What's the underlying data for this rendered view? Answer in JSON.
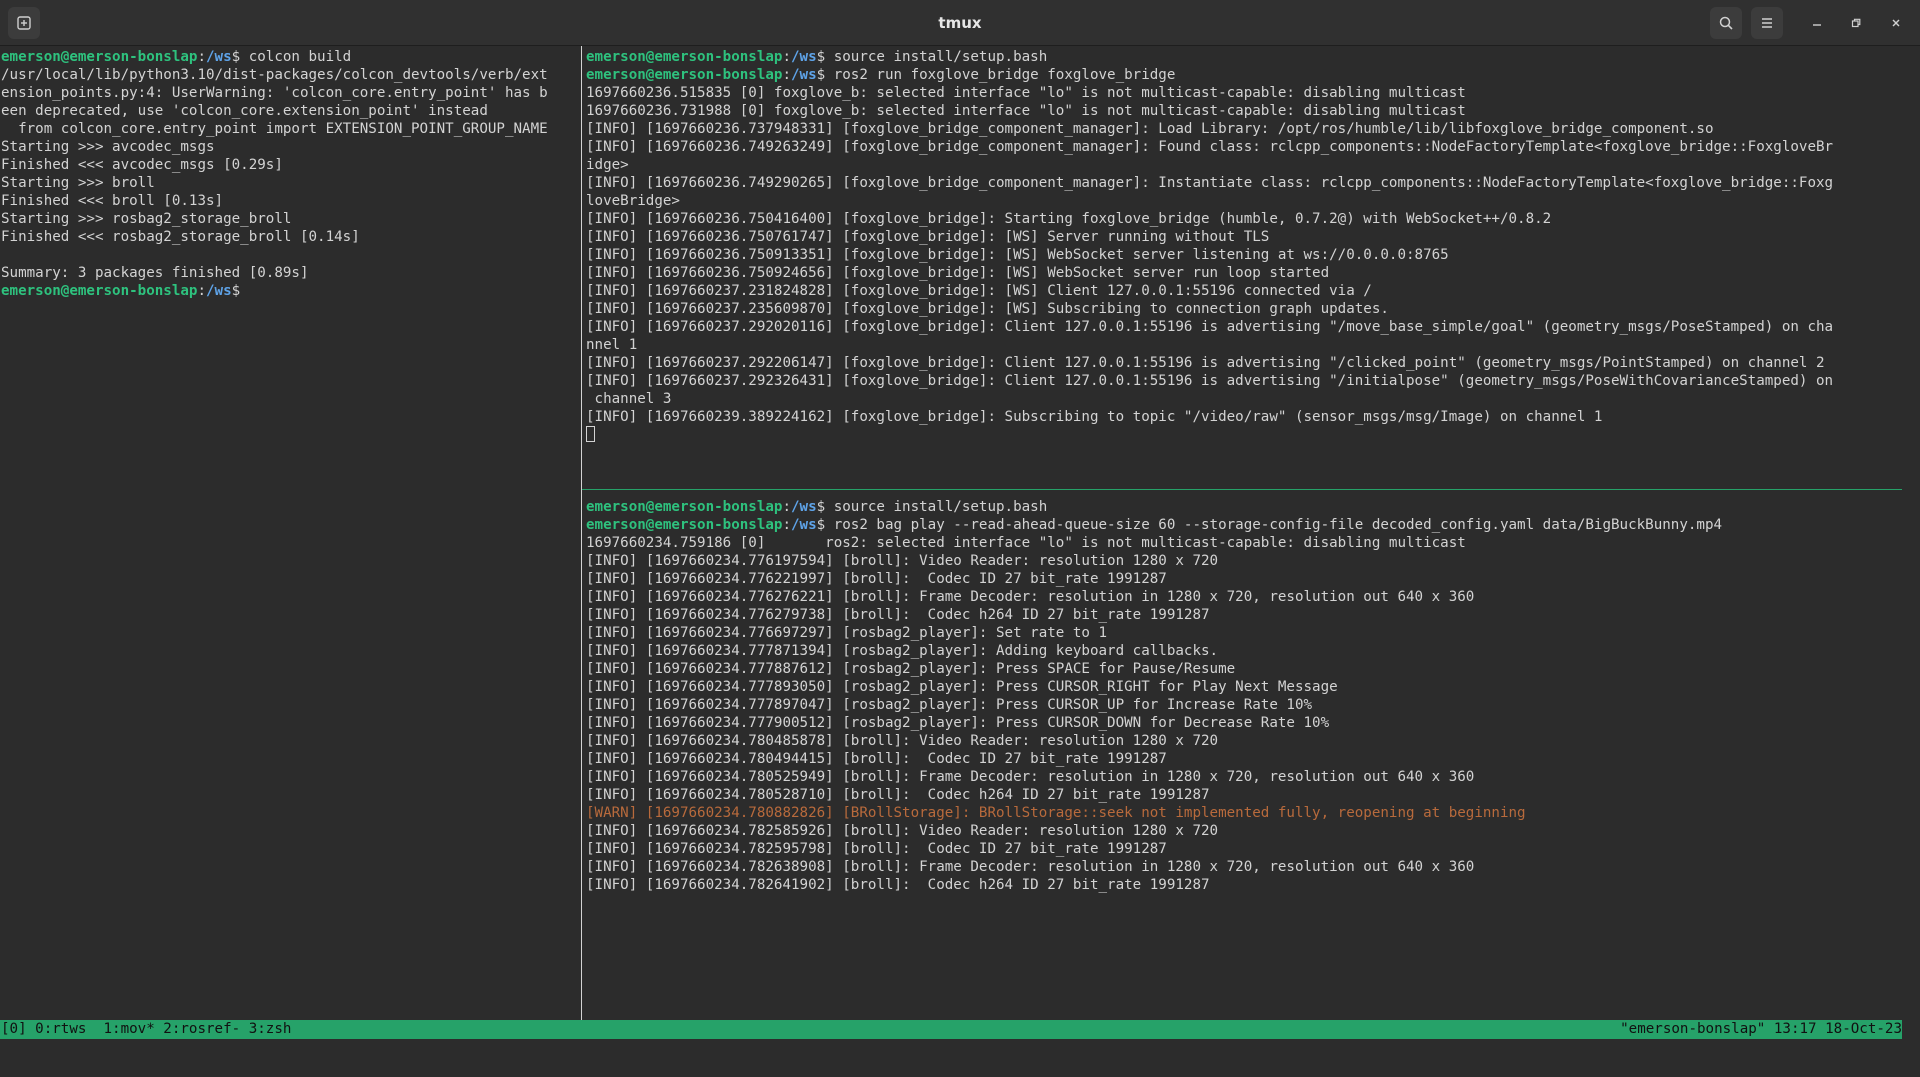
{
  "window": {
    "title": "tmux"
  },
  "colors": {
    "background": "#2c2c2c",
    "text": "#d3d3d3",
    "user": "#2ec27e",
    "path": "#5ea3e8",
    "warn": "#b86a3c",
    "statusbar": "#26a269",
    "separator_active": "#26a269"
  },
  "prompt": {
    "user_host": "emerson@emerson-bonslap",
    "sep": ":",
    "path": "/ws",
    "symbol": "$"
  },
  "left_pane": {
    "lines": [
      {
        "type": "prompt",
        "cmd": " colcon build"
      },
      {
        "type": "text",
        "text": "/usr/local/lib/python3.10/dist-packages/colcon_devtools/verb/ext"
      },
      {
        "type": "text",
        "text": "ension_points.py:4: UserWarning: 'colcon_core.entry_point' has b"
      },
      {
        "type": "text",
        "text": "een deprecated, use 'colcon_core.extension_point' instead"
      },
      {
        "type": "text",
        "text": "  from colcon_core.entry_point import EXTENSION_POINT_GROUP_NAME"
      },
      {
        "type": "text",
        "text": "Starting >>> avcodec_msgs"
      },
      {
        "type": "text",
        "text": "Finished <<< avcodec_msgs [0.29s]"
      },
      {
        "type": "text",
        "text": "Starting >>> broll"
      },
      {
        "type": "text",
        "text": "Finished <<< broll [0.13s]"
      },
      {
        "type": "text",
        "text": "Starting >>> rosbag2_storage_broll"
      },
      {
        "type": "text",
        "text": "Finished <<< rosbag2_storage_broll [0.14s]"
      },
      {
        "type": "text",
        "text": ""
      },
      {
        "type": "text",
        "text": "Summary: 3 packages finished [0.89s]"
      },
      {
        "type": "prompt",
        "cmd": ""
      }
    ]
  },
  "top_right_pane": {
    "lines": [
      {
        "type": "prompt",
        "cmd": " source install/setup.bash"
      },
      {
        "type": "prompt",
        "cmd": " ros2 run foxglove_bridge foxglove_bridge"
      },
      {
        "type": "text",
        "text": "1697660236.515835 [0] foxglove_b: selected interface \"lo\" is not multicast-capable: disabling multicast"
      },
      {
        "type": "text",
        "text": "1697660236.731988 [0] foxglove_b: selected interface \"lo\" is not multicast-capable: disabling multicast"
      },
      {
        "type": "text",
        "text": "[INFO] [1697660236.737948331] [foxglove_bridge_component_manager]: Load Library: /opt/ros/humble/lib/libfoxglove_bridge_component.so"
      },
      {
        "type": "text",
        "text": "[INFO] [1697660236.749263249] [foxglove_bridge_component_manager]: Found class: rclcpp_components::NodeFactoryTemplate<foxglove_bridge::FoxgloveBr"
      },
      {
        "type": "text",
        "text": "idge>"
      },
      {
        "type": "text",
        "text": "[INFO] [1697660236.749290265] [foxglove_bridge_component_manager]: Instantiate class: rclcpp_components::NodeFactoryTemplate<foxglove_bridge::Foxg"
      },
      {
        "type": "text",
        "text": "loveBridge>"
      },
      {
        "type": "text",
        "text": "[INFO] [1697660236.750416400] [foxglove_bridge]: Starting foxglove_bridge (humble, 0.7.2@) with WebSocket++/0.8.2"
      },
      {
        "type": "text",
        "text": "[INFO] [1697660236.750761747] [foxglove_bridge]: [WS] Server running without TLS"
      },
      {
        "type": "text",
        "text": "[INFO] [1697660236.750913351] [foxglove_bridge]: [WS] WebSocket server listening at ws://0.0.0.0:8765"
      },
      {
        "type": "text",
        "text": "[INFO] [1697660236.750924656] [foxglove_bridge]: [WS] WebSocket server run loop started"
      },
      {
        "type": "text",
        "text": "[INFO] [1697660237.231824828] [foxglove_bridge]: [WS] Client 127.0.0.1:55196 connected via /"
      },
      {
        "type": "text",
        "text": "[INFO] [1697660237.235609870] [foxglove_bridge]: [WS] Subscribing to connection graph updates."
      },
      {
        "type": "text",
        "text": "[INFO] [1697660237.292020116] [foxglove_bridge]: Client 127.0.0.1:55196 is advertising \"/move_base_simple/goal\" (geometry_msgs/PoseStamped) on cha"
      },
      {
        "type": "text",
        "text": "nnel 1"
      },
      {
        "type": "text",
        "text": "[INFO] [1697660237.292206147] [foxglove_bridge]: Client 127.0.0.1:55196 is advertising \"/clicked_point\" (geometry_msgs/PointStamped) on channel 2"
      },
      {
        "type": "text",
        "text": "[INFO] [1697660237.292326431] [foxglove_bridge]: Client 127.0.0.1:55196 is advertising \"/initialpose\" (geometry_msgs/PoseWithCovarianceStamped) on"
      },
      {
        "type": "text",
        "text": " channel 3"
      },
      {
        "type": "text",
        "text": "[INFO] [1697660239.389224162] [foxglove_bridge]: Subscribing to topic \"/video/raw\" (sensor_msgs/msg/Image) on channel 1"
      },
      {
        "type": "cursor"
      }
    ]
  },
  "bottom_right_pane": {
    "lines": [
      {
        "type": "prompt",
        "cmd": " source install/setup.bash"
      },
      {
        "type": "prompt",
        "cmd": " ros2 bag play --read-ahead-queue-size 60 --storage-config-file decoded_config.yaml data/BigBuckBunny.mp4"
      },
      {
        "type": "text",
        "text": "1697660234.759186 [0]       ros2: selected interface \"lo\" is not multicast-capable: disabling multicast"
      },
      {
        "type": "text",
        "text": "[INFO] [1697660234.776197594] [broll]: Video Reader: resolution 1280 x 720"
      },
      {
        "type": "text",
        "text": "[INFO] [1697660234.776221997] [broll]:  Codec ID 27 bit_rate 1991287"
      },
      {
        "type": "text",
        "text": "[INFO] [1697660234.776276221] [broll]: Frame Decoder: resolution in 1280 x 720, resolution out 640 x 360"
      },
      {
        "type": "text",
        "text": "[INFO] [1697660234.776279738] [broll]:  Codec h264 ID 27 bit_rate 1991287"
      },
      {
        "type": "text",
        "text": "[INFO] [1697660234.776697297] [rosbag2_player]: Set rate to 1"
      },
      {
        "type": "text",
        "text": "[INFO] [1697660234.777871394] [rosbag2_player]: Adding keyboard callbacks."
      },
      {
        "type": "text",
        "text": "[INFO] [1697660234.777887612] [rosbag2_player]: Press SPACE for Pause/Resume"
      },
      {
        "type": "text",
        "text": "[INFO] [1697660234.777893050] [rosbag2_player]: Press CURSOR_RIGHT for Play Next Message"
      },
      {
        "type": "text",
        "text": "[INFO] [1697660234.777897047] [rosbag2_player]: Press CURSOR_UP for Increase Rate 10%"
      },
      {
        "type": "text",
        "text": "[INFO] [1697660234.777900512] [rosbag2_player]: Press CURSOR_DOWN for Decrease Rate 10%"
      },
      {
        "type": "text",
        "text": "[INFO] [1697660234.780485878] [broll]: Video Reader: resolution 1280 x 720"
      },
      {
        "type": "text",
        "text": "[INFO] [1697660234.780494415] [broll]:  Codec ID 27 bit_rate 1991287"
      },
      {
        "type": "text",
        "text": "[INFO] [1697660234.780525949] [broll]: Frame Decoder: resolution in 1280 x 720, resolution out 640 x 360"
      },
      {
        "type": "text",
        "text": "[INFO] [1697660234.780528710] [broll]:  Codec h264 ID 27 bit_rate 1991287"
      },
      {
        "type": "warn",
        "text": "[WARN] [1697660234.780882826] [BRollStorage]: BRollStorage::seek not implemented fully, reopening at beginning"
      },
      {
        "type": "text",
        "text": "[INFO] [1697660234.782585926] [broll]: Video Reader: resolution 1280 x 720"
      },
      {
        "type": "text",
        "text": "[INFO] [1697660234.782595798] [broll]:  Codec ID 27 bit_rate 1991287"
      },
      {
        "type": "text",
        "text": "[INFO] [1697660234.782638908] [broll]: Frame Decoder: resolution in 1280 x 720, resolution out 640 x 360"
      },
      {
        "type": "text",
        "text": "[INFO] [1697660234.782641902] [broll]:  Codec h264 ID 27 bit_rate 1991287"
      }
    ]
  },
  "statusbar": {
    "left": "[0] 0:rtws  1:mov* 2:rosref- 3:zsh",
    "right": "\"emerson-bonslap\" 13:17 18-Oct-23"
  },
  "icons": {
    "new_tab": "new-tab-icon",
    "search": "search-icon",
    "menu": "hamburger-menu-icon",
    "minimize": "minimize-icon",
    "maximize": "maximize-icon",
    "close": "close-icon"
  }
}
